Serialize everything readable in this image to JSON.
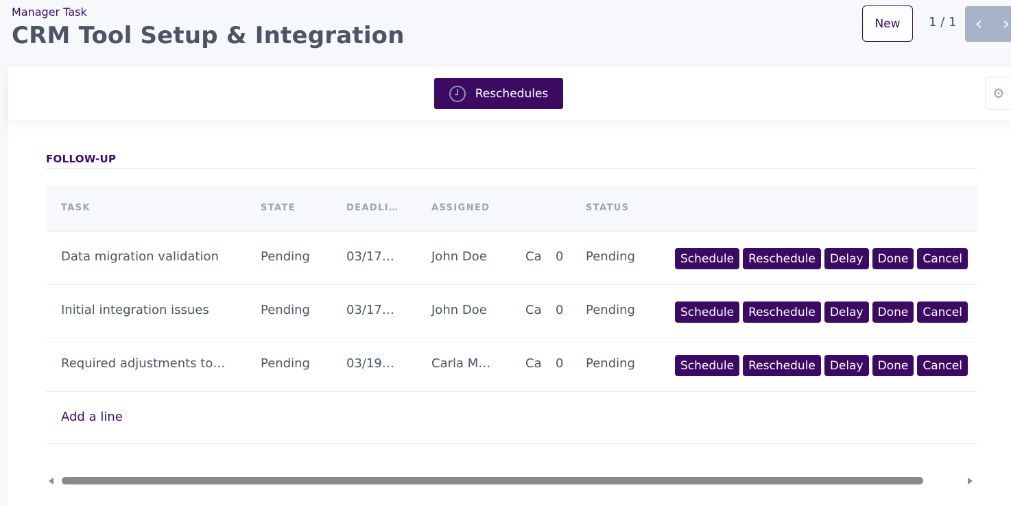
{
  "header": {
    "breadcrumb": "Manager Task",
    "title": "CRM Tool Setup & Integration",
    "new_label": "New",
    "pager": "1 / 1",
    "prev_icon": "chevron-left-icon",
    "next_icon": "chevron-right-icon"
  },
  "toolbar": {
    "reschedules_label": "Reschedules",
    "reschedules_icon": "clock-icon",
    "settings_icon": "gear-icon"
  },
  "section": {
    "title": "FOLLOW-UP"
  },
  "table": {
    "columns": [
      "TASK",
      "STATE",
      "DEADLI…",
      "ASSIGNED",
      "STATUS"
    ],
    "rows": [
      {
        "task": "Data migration validation",
        "state": "Pending",
        "deadline": "03/17…",
        "assigned": "John Doe",
        "col5": "Ca",
        "count": "0",
        "status": "Pending"
      },
      {
        "task": "Initial integration issues",
        "state": "Pending",
        "deadline": "03/17…",
        "assigned": "John Doe",
        "col5": "Ca",
        "count": "0",
        "status": "Pending"
      },
      {
        "task": "Required adjustments to…",
        "state": "Pending",
        "deadline": "03/19…",
        "assigned": "Carla M…",
        "col5": "Ca",
        "count": "0",
        "status": "Pending"
      }
    ],
    "actions": [
      "Schedule",
      "Reschedule",
      "Delay",
      "Done",
      "Cancel"
    ],
    "add_line": "Add a line"
  },
  "colors": {
    "accent": "#3d0a63",
    "nav_bg": "#a7b3c9"
  }
}
